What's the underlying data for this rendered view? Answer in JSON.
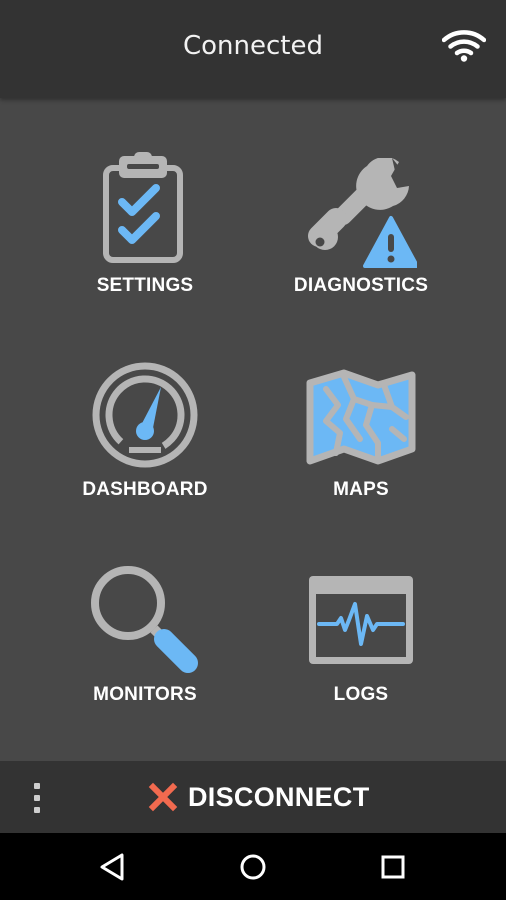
{
  "header": {
    "title": "Connected",
    "wifi_icon": "wifi-icon"
  },
  "tiles": {
    "settings": {
      "label": "SETTINGS",
      "icon": "clipboard-check-icon"
    },
    "diagnostics": {
      "label": "DIAGNOSTICS",
      "icon": "wrench-warning-icon"
    },
    "dashboard": {
      "label": "DASHBOARD",
      "icon": "gauge-icon"
    },
    "maps": {
      "label": "MAPS",
      "icon": "map-icon"
    },
    "monitors": {
      "label": "MONITORS",
      "icon": "magnifier-icon"
    },
    "logs": {
      "label": "LOGS",
      "icon": "waveform-log-icon"
    }
  },
  "bottom_bar": {
    "menu_icon": "overflow-menu-icon",
    "disconnect_label": "DISCONNECT",
    "disconnect_icon": "close-x-icon"
  },
  "navbar": {
    "back": "back-icon",
    "home": "home-icon",
    "recents": "recents-icon"
  },
  "colors": {
    "header_bg": "#333333",
    "grid_bg": "#484848",
    "icon_gray": "#b5b5b5",
    "icon_blue": "#6cb8f5",
    "accent_red": "#f26a4f"
  }
}
